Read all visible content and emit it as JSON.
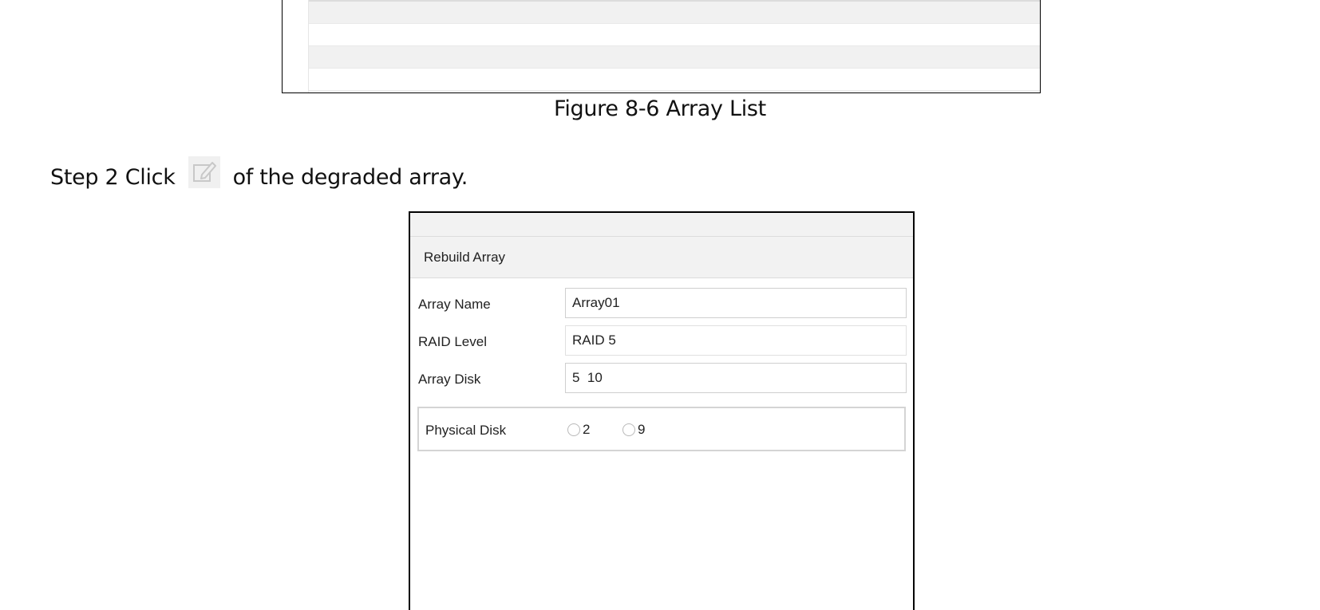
{
  "figure": {
    "caption": "Figure 8-6 Array List"
  },
  "step": {
    "prefix": "Step 2 Click",
    "suffix": "of the degraded array.",
    "icon": "edit-icon"
  },
  "dialog": {
    "title": "Rebuild Array",
    "fields": [
      {
        "label": "Array Name",
        "value": "Array01"
      },
      {
        "label": "RAID Level",
        "value": "RAID 5"
      },
      {
        "label": "Array Disk",
        "value": "5  10"
      }
    ],
    "physical_disk": {
      "label": "Physical Disk",
      "options": [
        "2",
        "9"
      ]
    }
  }
}
